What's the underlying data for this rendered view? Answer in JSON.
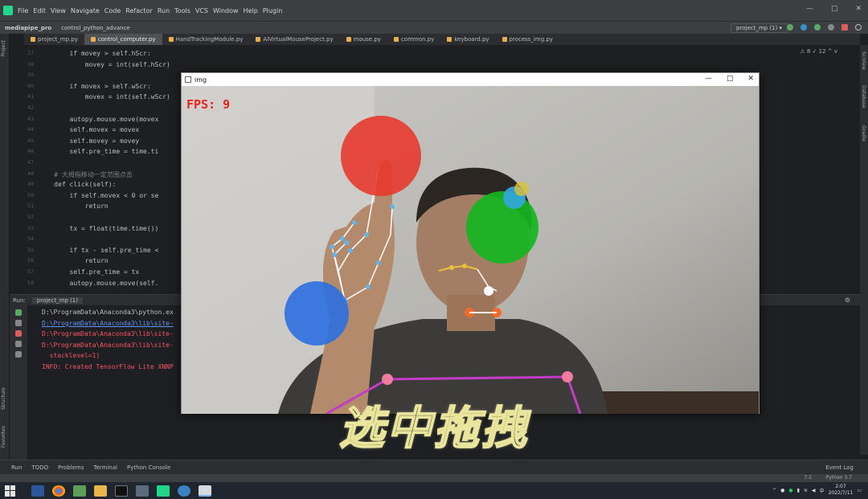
{
  "menubar": {
    "items": [
      "File",
      "Edit",
      "View",
      "Navigate",
      "Code",
      "Refactor",
      "Run",
      "Tools",
      "VCS",
      "Window",
      "Help",
      "Plugin"
    ]
  },
  "navbar": {
    "crumbs": [
      "mediapipe_pro",
      "control_python_advance"
    ],
    "run_config": "project_mp (1)"
  },
  "tabs": [
    {
      "label": "project_mp.py",
      "active": false
    },
    {
      "label": "control_computer.py",
      "active": true
    },
    {
      "label": "HandTrackingModule.py",
      "active": false
    },
    {
      "label": "AIVirtualMouseProject.py",
      "active": false
    },
    {
      "label": "mouse.py",
      "active": false
    },
    {
      "label": "common.py",
      "active": false
    },
    {
      "label": "keyboard.py",
      "active": false
    },
    {
      "label": "process_img.py",
      "active": false
    }
  ],
  "editor": {
    "hint": "⚠ 8  ✓ 12  ^  v",
    "lines": [
      {
        "n": "37",
        "text": "        if movey > self.hScr:"
      },
      {
        "n": "38",
        "text": "            movey = int(self.hScr)"
      },
      {
        "n": "39",
        "text": ""
      },
      {
        "n": "40",
        "text": "        if movex > self.wScr:"
      },
      {
        "n": "41",
        "text": "            movex = int(self.wScr)"
      },
      {
        "n": "42",
        "text": ""
      },
      {
        "n": "43",
        "text": "        autopy.mouse.move(movex"
      },
      {
        "n": "44",
        "text": "        self.movex = movex"
      },
      {
        "n": "45",
        "text": "        self.movey = movey"
      },
      {
        "n": "46",
        "text": "        self.pre_time = time.ti"
      },
      {
        "n": "47",
        "text": ""
      },
      {
        "n": "48",
        "text": "    # 大拇指移动一定范围点击"
      },
      {
        "n": "49",
        "text": "    def click(self):"
      },
      {
        "n": "50",
        "text": "        if self.movex < 0 or se"
      },
      {
        "n": "51",
        "text": "            return"
      },
      {
        "n": "52",
        "text": ""
      },
      {
        "n": "53",
        "text": "        tx = float(time.time())"
      },
      {
        "n": "54",
        "text": ""
      },
      {
        "n": "55",
        "text": "        if tx - self.pre_time <"
      },
      {
        "n": "56",
        "text": "            return"
      },
      {
        "n": "57",
        "text": "        self.pre_time = tx"
      },
      {
        "n": "58",
        "text": "        autopy.mouse.move(self."
      }
    ]
  },
  "run_panel": {
    "label": "Run:",
    "config": "project_mp (1)",
    "console": [
      {
        "kind": "normal",
        "text": "D:\\ProgramData\\Anaconda3\\python.ex"
      },
      {
        "kind": "link",
        "text": "D:\\ProgramData\\Anaconda3\\lib\\site-"
      },
      {
        "kind": "err",
        "text": "D:\\ProgramData\\Anaconda3\\lib\\site-"
      },
      {
        "kind": "err",
        "text": "D:\\ProgramData\\Anaconda3\\lib\\site-"
      },
      {
        "kind": "err",
        "text": "  stacklevel=1)"
      },
      {
        "kind": "err",
        "text": "INFO: Created TensorFlow Lite XNNP"
      }
    ]
  },
  "bottom_bar": {
    "items": [
      "Run",
      "TODO",
      "Problems",
      "Terminal",
      "Python Console"
    ],
    "event_log": "Event Log"
  },
  "status_bar": {
    "position": "7:1",
    "interpreter": "Python 3.7"
  },
  "left_strip": {
    "labels": [
      "Project",
      "Structure",
      "Favorites"
    ]
  },
  "right_strip": {
    "labels": [
      "SciView",
      "Database",
      "Gradle"
    ]
  },
  "cam_window": {
    "title": "img",
    "fps_text": "FPS: 9"
  },
  "caption": "选中拖拽",
  "taskbar": {
    "time": "2:07",
    "date": "2022/7/11",
    "ime": "中"
  }
}
